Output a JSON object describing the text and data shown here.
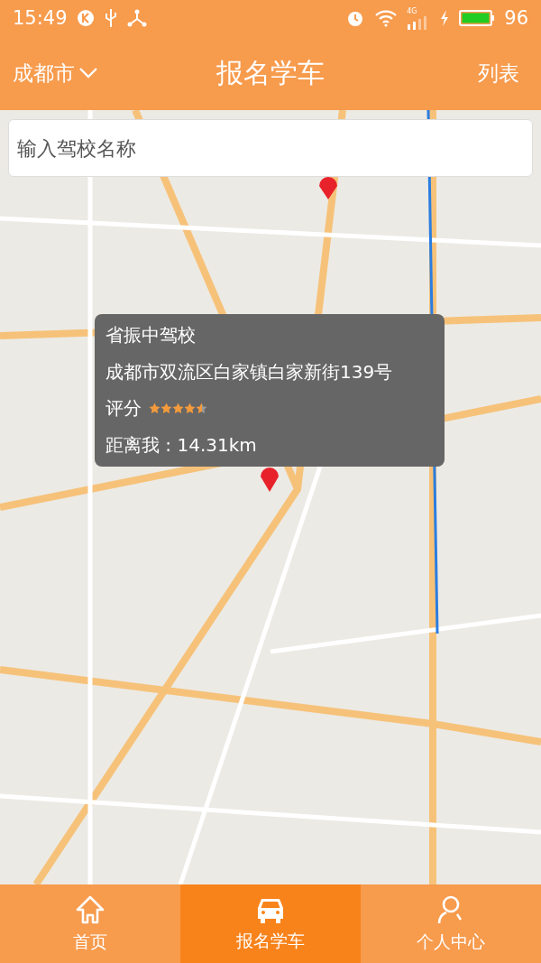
{
  "status_bar": {
    "time": "15:49",
    "network": "4G",
    "battery": "96"
  },
  "header": {
    "city": "成都市",
    "title": "报名学车",
    "action": "列表"
  },
  "search": {
    "placeholder": "输入驾校名称"
  },
  "popup": {
    "name": "省振中驾校",
    "address": "成都市双流区白家镇白家新街139号",
    "rating_label": "评分",
    "stars": 4.5,
    "distance": "距离我 : 14.31km"
  },
  "tabs": [
    {
      "label": "首页",
      "kind": "home",
      "selected": false
    },
    {
      "label": "报名学车",
      "kind": "car",
      "selected": true
    },
    {
      "label": "个人中心",
      "kind": "person",
      "selected": false
    }
  ]
}
